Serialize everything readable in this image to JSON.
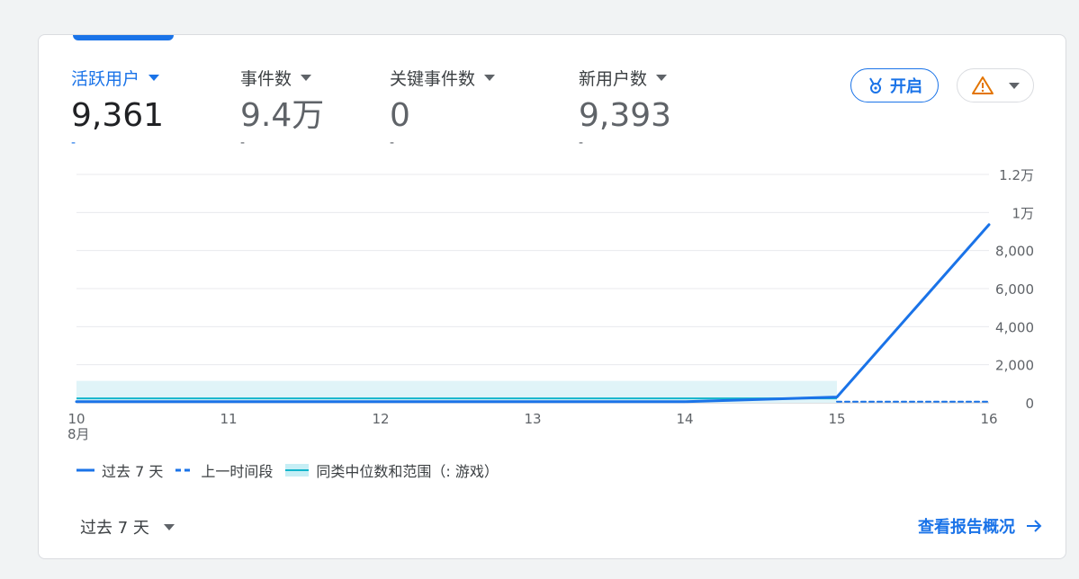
{
  "metrics": [
    {
      "label": "活跃用户",
      "value": "9,361",
      "delta": "-",
      "active": true
    },
    {
      "label": "事件数",
      "value": "9.4万",
      "delta": "-",
      "active": false
    },
    {
      "label": "关键事件数",
      "value": "0",
      "delta": "-",
      "active": false
    },
    {
      "label": "新用户数",
      "value": "9,393",
      "delta": "-",
      "active": false
    }
  ],
  "actions": {
    "enable_label": "开启",
    "enable_icon": "medal-icon",
    "alert_icon": "warning-triangle-icon"
  },
  "colors": {
    "accent": "#1a73e8",
    "band": "#e0f4f8",
    "median": "#12b5cb",
    "warning": "#e37400"
  },
  "chart_data": {
    "type": "line",
    "x": [
      "10",
      "11",
      "12",
      "13",
      "14",
      "15",
      "16"
    ],
    "x_sublabel": "8月",
    "y_ticks": [
      "0",
      "2,000",
      "4,000",
      "6,000",
      "8,000",
      "1万",
      "1.2万"
    ],
    "ylim": [
      0,
      12000
    ],
    "grid": true,
    "series": [
      {
        "name": "过去 7 天",
        "style": "solid",
        "values": [
          60,
          60,
          60,
          60,
          60,
          300,
          9361
        ]
      },
      {
        "name": "上一时间段",
        "style": "dashed",
        "values": [
          null,
          null,
          null,
          null,
          null,
          60,
          60
        ]
      }
    ],
    "benchmark": {
      "name": "同类中位数和范围（: 游戏）",
      "median": [
        230,
        230,
        230,
        230,
        230,
        230
      ],
      "low": [
        0,
        0,
        0,
        0,
        0,
        0
      ],
      "high": [
        1150,
        1150,
        1150,
        1150,
        1150,
        1150
      ]
    }
  },
  "footer": {
    "period_label": "过去 7 天",
    "report_link": "查看报告概况"
  }
}
